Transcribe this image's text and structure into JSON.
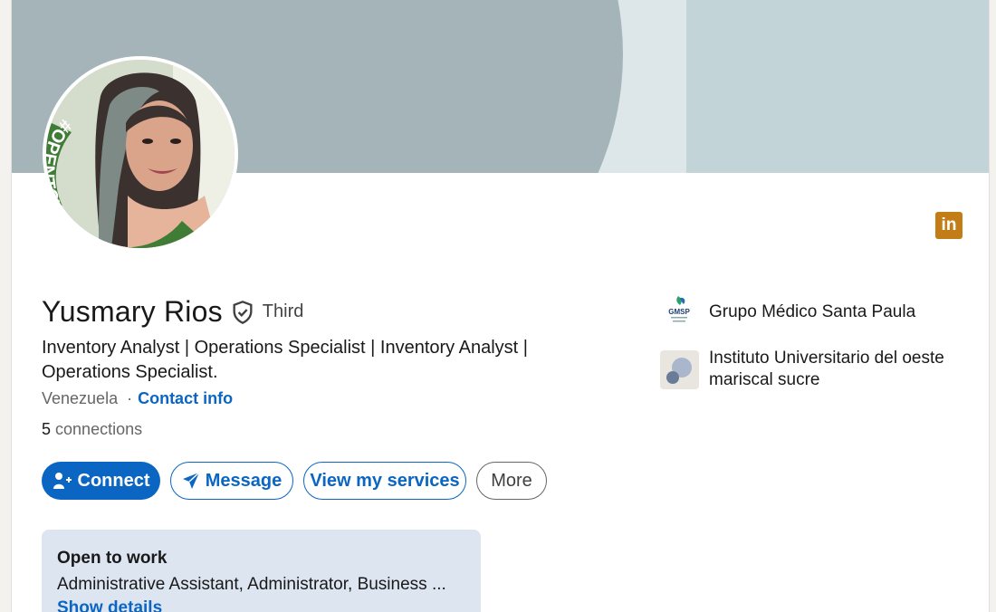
{
  "profile": {
    "name": "Yusmary Rios",
    "degree": "Third",
    "headline": "Inventory Analyst | Operations Specialist | Inventory Analyst | Operations Specialist.",
    "location": "Venezuela",
    "contact_info_label": "Contact info",
    "connections_count": "5",
    "connections_label": "connections",
    "avatar_badge": "#OPENTOWORK"
  },
  "actions": {
    "connect": "Connect",
    "message": "Message",
    "view_services": "View my services",
    "more": "More"
  },
  "companies": [
    {
      "name": "Grupo Médico Santa Paula",
      "logo_text": "GMSP"
    },
    {
      "name": "Instituto Universitario del oeste mariscal sucre"
    }
  ],
  "open_to_work": {
    "title": "Open to work",
    "roles": "Administrative Assistant, Administrator, Business ...",
    "show_details": "Show details"
  },
  "brand": {
    "linkedin_logo": "in",
    "accent": "#0a66c2",
    "otw_green": "#3f7d37"
  }
}
